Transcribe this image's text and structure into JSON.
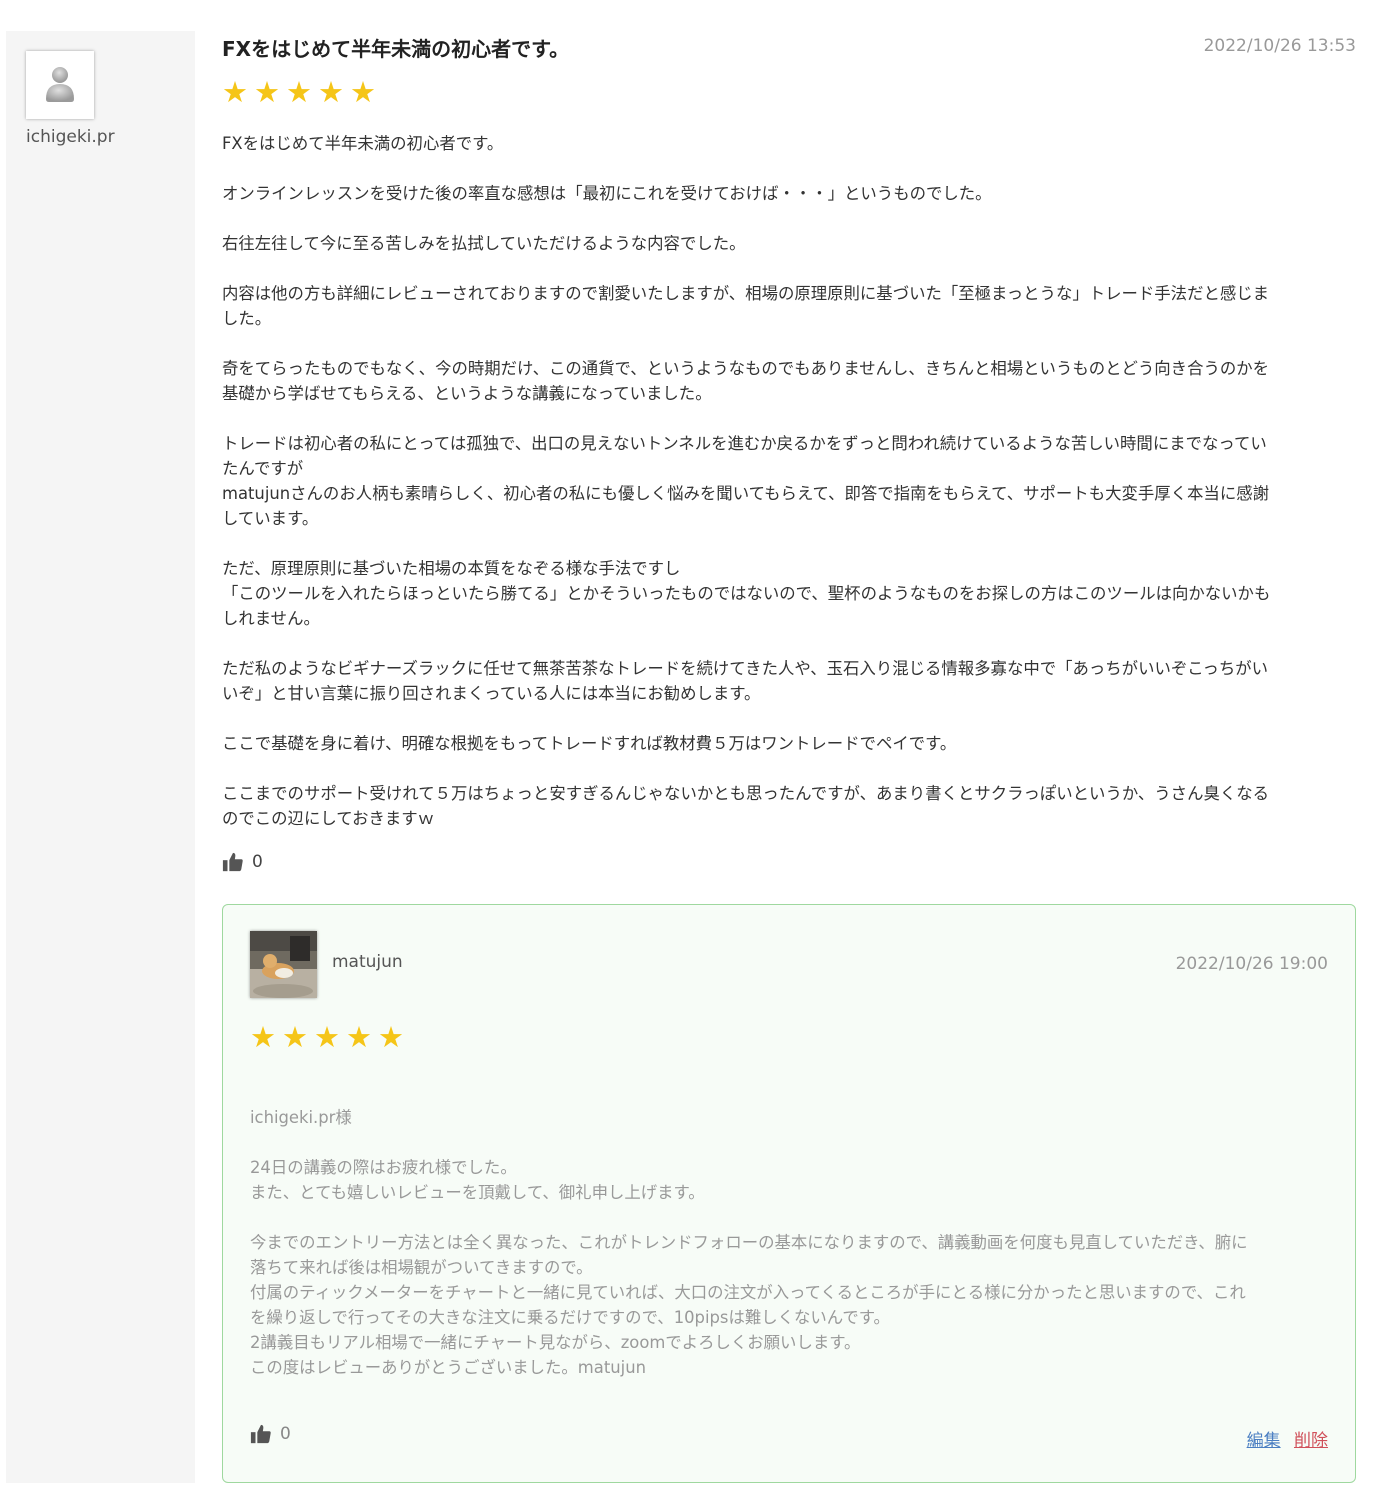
{
  "reviewer": {
    "name": "ichigeki.pr"
  },
  "review": {
    "title": "FXをはじめて半年未満の初心者です。",
    "date": "2022/10/26 13:53",
    "rating": 5,
    "stars": "★★★★★",
    "paragraphs": [
      [
        "FXをはじめて半年未満の初心者です。"
      ],
      [
        "オンラインレッスンを受けた後の率直な感想は「最初にこれを受けておけば・・・」というものでした。"
      ],
      [
        "右往左往して今に至る苦しみを払拭していただけるような内容でした。"
      ],
      [
        "内容は他の方も詳細にレビューされておりますので割愛いたしますが、相場の原理原則に基づいた「至極まっとうな」トレード手法だと感じま",
        "した。"
      ],
      [
        "奇をてらったものでもなく、今の時期だけ、この通貨で、というようなものでもありませんし、きちんと相場というものとどう向き合うのかを",
        "基礎から学ばせてもらえる、というような講義になっていました。"
      ],
      [
        "トレードは初心者の私にとっては孤独で、出口の見えないトンネルを進むか戻るかをずっと問われ続けているような苦しい時間にまでなってい",
        "たんですが",
        "matujunさんのお人柄も素晴らしく、初心者の私にも優しく悩みを聞いてもらえて、即答で指南をもらえて、サポートも大変手厚く本当に感謝",
        "しています。"
      ],
      [
        "ただ、原理原則に基づいた相場の本質をなぞる様な手法ですし",
        "「このツールを入れたらほっといたら勝てる」とかそういったものではないので、聖杯のようなものをお探しの方はこのツールは向かないかも",
        "しれません。"
      ],
      [
        "ただ私のようなビギナーズラックに任せて無茶苦茶なトレードを続けてきた人や、玉石入り混じる情報多寡な中で「あっちがいいぞこっちがい",
        "いぞ」と甘い言葉に振り回されまくっている人には本当にお勧めします。"
      ],
      [
        "ここで基礎を身に着け、明確な根拠をもってトレードすれば教材費５万はワントレードでペイです。"
      ],
      [
        "ここまでのサポート受けれて５万はちょっと安すぎるんじゃないかとも思ったんですが、あまり書くとサクラっぽいというか、うさん臭くなる",
        "のでこの辺にしておきますｗ"
      ]
    ],
    "likes": "0"
  },
  "reply": {
    "name": "matujun",
    "date": "2022/10/26 19:00",
    "rating": 5,
    "stars": "★★★★★",
    "paragraphs": [
      [
        "ichigeki.pr様"
      ],
      [
        "24日の講義の際はお疲れ様でした。",
        "また、とても嬉しいレビューを頂戴して、御礼申し上げます。"
      ],
      [
        "今までのエントリー方法とは全く異なった、これがトレンドフォローの基本になりますので、講義動画を何度も見直していただき、腑に",
        "落ちて来れば後は相場観がついてきますので。",
        "付属のティックメーターをチャートと一緒に見ていれば、大口の注文が入ってくるところが手にとる様に分かったと思いますので、これ",
        "を繰り返しで行ってその大きな注文に乗るだけですので、10pipsは難しくないんです。",
        "2講義目もリアル相場で一緒にチャート見ながら、zoomでよろしくお願いします。",
        "この度はレビューありがとうございました。matujun"
      ]
    ],
    "likes": "0",
    "edit_label": "編集",
    "delete_label": "削除"
  },
  "colors": {
    "star": "#f5c518",
    "reply_border": "#9fd89f",
    "edit": "#4a7ec2",
    "delete": "#d0505a"
  }
}
